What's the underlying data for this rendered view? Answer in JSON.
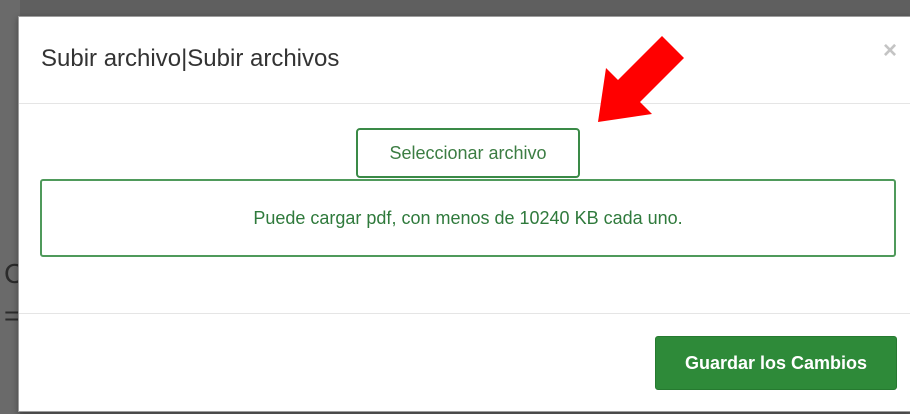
{
  "modal": {
    "title": "Subir archivo|Subir archivos",
    "close_glyph": "×",
    "select_file_label": "Seleccionar archivo",
    "info_text": "Puede cargar pdf, con menos de 10240 KB cada uno.",
    "save_label": "Guardar los Cambios"
  },
  "backdrop": {
    "glyphs": [
      "C",
      "="
    ]
  },
  "annotation": {
    "arrow_icon": "red-arrow-icon",
    "arrow_color": "#ff0000"
  },
  "colors": {
    "primary_green": "#2e8a39",
    "success_text": "#2f7a3c",
    "overlay": "#5f5f5f"
  }
}
